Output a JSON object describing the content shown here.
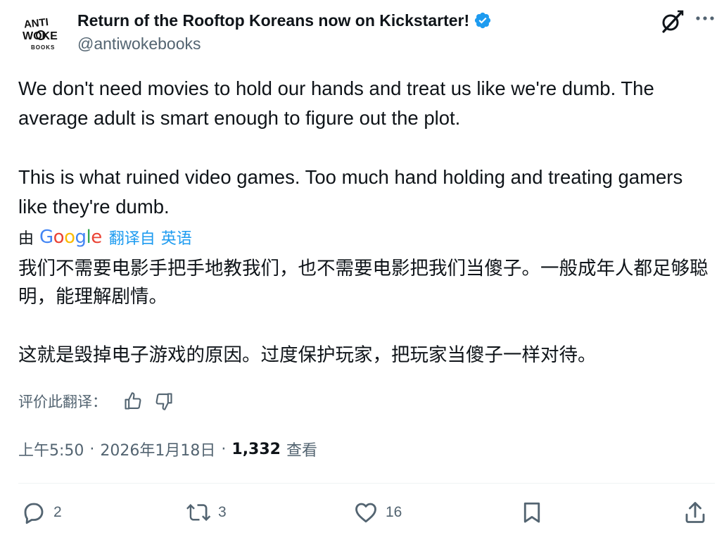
{
  "author": {
    "display_name": "Return of the Rooftop Koreans now on Kickstarter!",
    "handle": "@antiwokebooks",
    "avatar_text": {
      "line1": "ANTI",
      "line2": "WOKE",
      "line3": "BOOKS"
    },
    "verified_color": "#1d9bf0"
  },
  "tweet": {
    "paragraphs": [
      "We don't need movies to hold our hands and treat us like we're dumb. The average adult is smart enough to figure out the plot.",
      "This is what ruined video games. Too much hand holding and treating gamers like they're dumb."
    ]
  },
  "translation_header": {
    "by_label": "由",
    "provider": "Google",
    "translated_from": "翻译自",
    "language": "英语"
  },
  "translation": {
    "paragraphs": [
      "我们不需要电影手把手地教我们，也不需要电影把我们当傻子。一般成年人都足够聪明，能理解剧情。",
      "这就是毁掉电子游戏的原因。过度保护玩家，把玩家当傻子一样对待。"
    ]
  },
  "rate": {
    "label": "评价此翻译：",
    "up_icon": "thumbs-up-icon",
    "down_icon": "thumbs-down-icon"
  },
  "meta": {
    "time": "上午5:50",
    "separator": "·",
    "date": "2026年1月18日",
    "views_count": "1,332",
    "views_label": "查看"
  },
  "actions": {
    "replies": "2",
    "reposts": "3",
    "likes": "16"
  },
  "colors": {
    "text": "#0f1419",
    "secondary": "#536471",
    "accent": "#1d9bf0"
  }
}
